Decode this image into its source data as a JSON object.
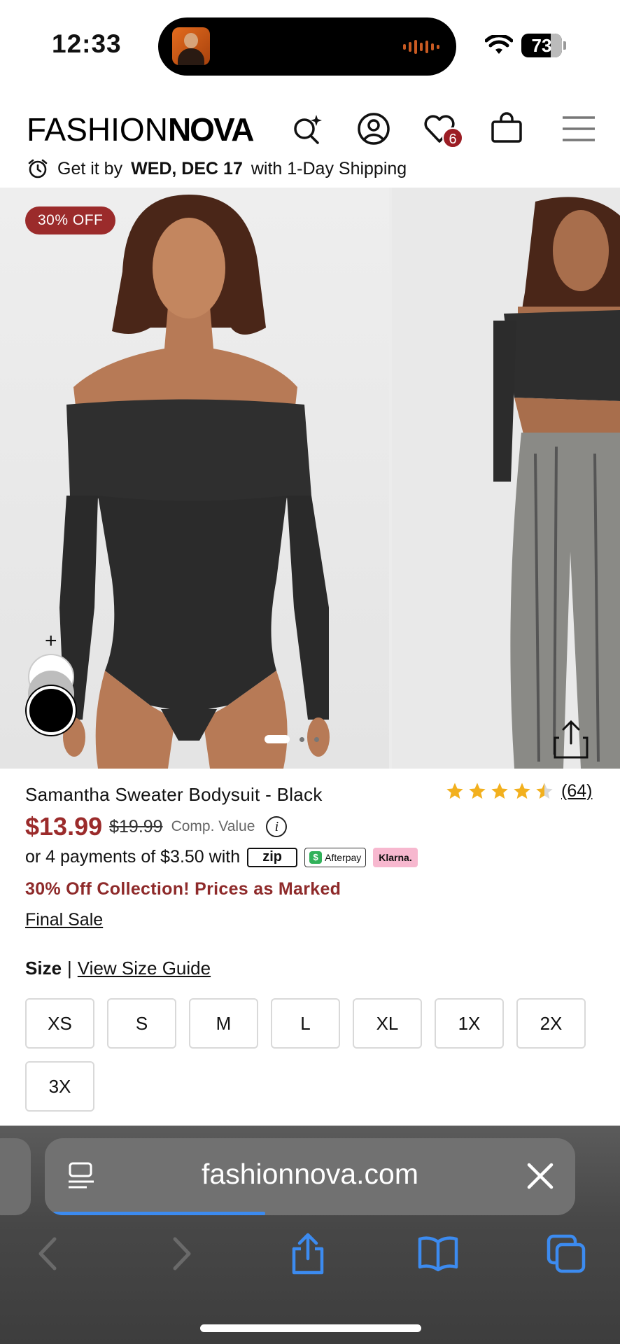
{
  "status_bar": {
    "time": "12:33",
    "battery": "73"
  },
  "header": {
    "logo_light": "FASHION",
    "logo_bold": "NOVA",
    "wishlist_count": "6",
    "shipping_prefix": "Get it by",
    "shipping_date": "WED, DEC 17",
    "shipping_suffix": "with 1-Day Shipping"
  },
  "gallery": {
    "discount_badge": "30% OFF",
    "swatch_plus": "+"
  },
  "product": {
    "title": "Samantha Sweater Bodysuit - Black",
    "rating": 4.5,
    "rating_count": "(64)",
    "price": "$13.99",
    "compare_price": "$19.99",
    "comp_label": "Comp. Value",
    "info_glyph": "i",
    "installments": "or 4 payments of $3.50 with",
    "pay_zip": "zip",
    "pay_afterpay": "Afterpay",
    "pay_klarna": "Klarna.",
    "promo": "30% Off Collection! Prices as Marked",
    "final_sale": "Final Sale"
  },
  "size_section": {
    "label": "Size",
    "divider": "|",
    "guide_link": "View Size Guide",
    "sizes": [
      "XS",
      "S",
      "M",
      "L",
      "XL",
      "1X",
      "2X",
      "3X"
    ]
  },
  "browser": {
    "url": "fashionnova.com",
    "load_progress": 0.4
  },
  "colors": {
    "accent_red": "#9b2b2b",
    "star_gold": "#f2b01e",
    "browser_blue": "#3c8bf0"
  }
}
